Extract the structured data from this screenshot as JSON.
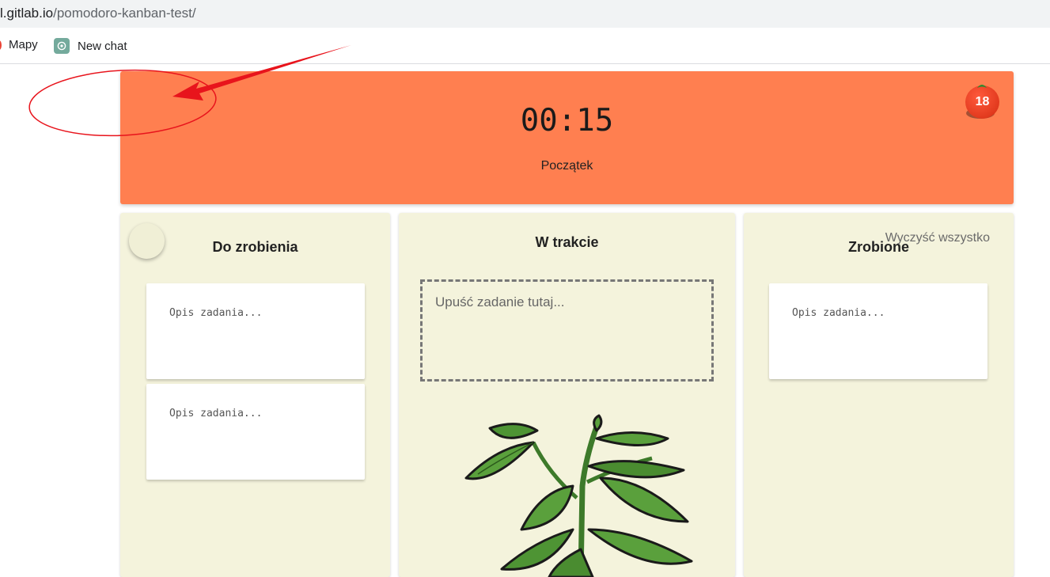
{
  "browser": {
    "url_host": "l.gitlab.io",
    "url_path": "/pomodoro-kanban-test/",
    "bookmarks": [
      {
        "label": "Mapy",
        "icon": "maps-pin-icon"
      },
      {
        "label": "New chat",
        "icon": "chatgpt-icon"
      }
    ]
  },
  "timer": {
    "time": "00:15",
    "label": "Początek",
    "pomodoro_count": "18",
    "background_color": "#ff7f50"
  },
  "columns": [
    {
      "title": "Do zrobienia",
      "cards": [
        {
          "placeholder": "Opis zadania..."
        },
        {
          "placeholder": "Opis zadania..."
        }
      ]
    },
    {
      "title": "W trakcie",
      "dropzone_text": "Upuść zadanie tutaj..."
    },
    {
      "title": "Zrobione",
      "clear_label": "Wyczyść wszystko",
      "cards": [
        {
          "placeholder": "Opis zadania..."
        }
      ]
    }
  ],
  "colors": {
    "column_background": "#f4f3dc",
    "annotation": "#e8141c"
  }
}
